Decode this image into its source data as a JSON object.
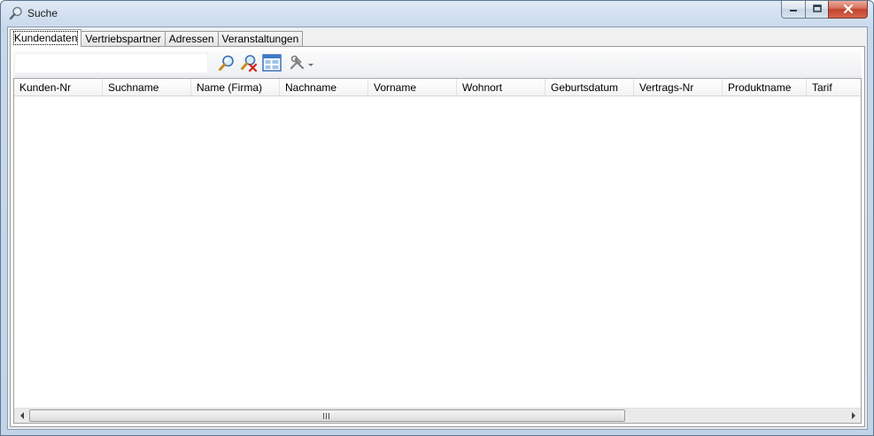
{
  "window": {
    "title": "Suche"
  },
  "tabs": [
    {
      "label": "Kundendaten",
      "active": true
    },
    {
      "label": "Vertriebspartner",
      "active": false
    },
    {
      "label": "Adressen",
      "active": false
    },
    {
      "label": "Veranstaltungen",
      "active": false
    }
  ],
  "search": {
    "value": "",
    "placeholder": ""
  },
  "toolbar": {
    "buttons": [
      {
        "icon": "magnifier-search-icon"
      },
      {
        "icon": "magnifier-clear-icon"
      },
      {
        "icon": "columns-view-icon"
      },
      {
        "icon": "tools-dropdown-icon"
      }
    ]
  },
  "grid": {
    "columns": [
      "Kunden-Nr",
      "Suchname",
      "Name (Firma)",
      "Nachname",
      "Vorname",
      "Wohnort",
      "Geburtsdatum",
      "Vertrags-Nr",
      "Produktname",
      "Tarif"
    ],
    "rows": []
  },
  "colors": {
    "title_bar": "#c9d9ec",
    "close_button": "#c2412b",
    "window_border": "#5e7590"
  }
}
